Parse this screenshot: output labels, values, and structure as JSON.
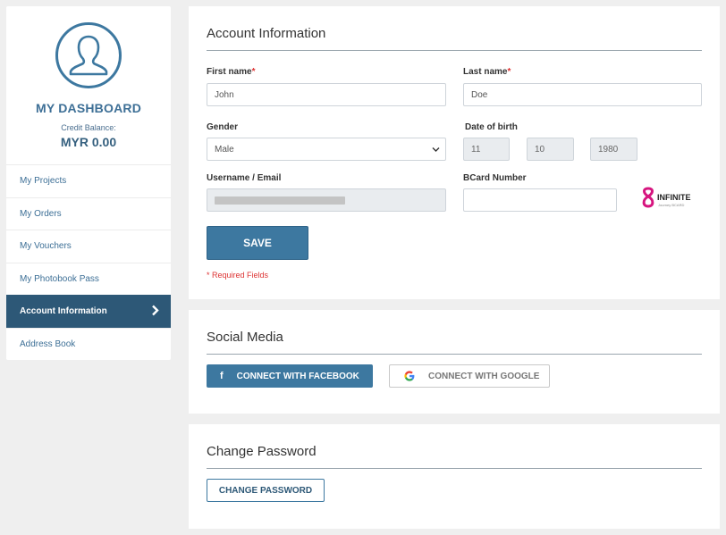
{
  "sidebar": {
    "title": "MY DASHBOARD",
    "credit_label": "Credit Balance:",
    "credit_value": "MYR 0.00",
    "items": [
      {
        "label": "My Projects"
      },
      {
        "label": "My Orders"
      },
      {
        "label": "My Vouchers"
      },
      {
        "label": "My Photobook Pass"
      },
      {
        "label": "Account Information",
        "active": true
      },
      {
        "label": "Address Book"
      }
    ]
  },
  "account": {
    "title": "Account Information",
    "first_name_label": "First name",
    "first_name_value": "John",
    "last_name_label": "Last name",
    "last_name_value": "Doe",
    "required_mark": "*",
    "gender_label": "Gender",
    "gender_value": "Male",
    "dob_label": "Date of birth",
    "dob_day": "11",
    "dob_month": "10",
    "dob_year": "1980",
    "username_label": "Username / Email",
    "bcard_label": "BCard Number",
    "bcard_value": "",
    "brand_name": "INFINITE",
    "brand_sub": "Journey BCARD",
    "save_label": "SAVE",
    "required_note": "* Required Fields"
  },
  "social": {
    "title": "Social Media",
    "facebook_label": "CONNECT WITH FACEBOOK",
    "google_label": "CONNECT WITH GOOGLE"
  },
  "password": {
    "title": "Change Password",
    "button_label": "CHANGE PASSWORD"
  },
  "colors": {
    "primary": "#3d78a0",
    "nav_active": "#2d5877",
    "required": "#dd3333",
    "brand_pink": "#d6157f"
  }
}
